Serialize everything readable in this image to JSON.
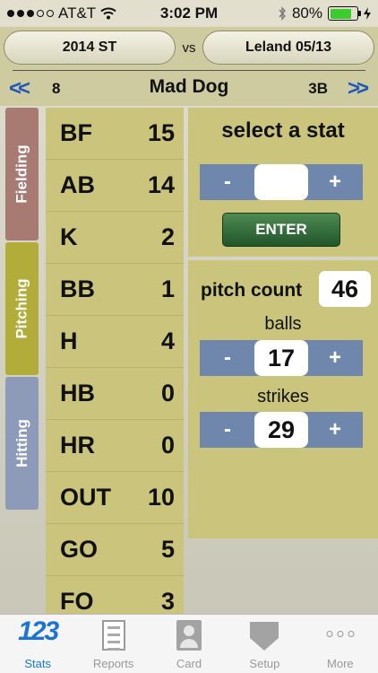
{
  "status_bar": {
    "carrier": "AT&T",
    "time": "3:02 PM",
    "battery": "80%",
    "battery_level": 0.8
  },
  "header": {
    "season_label": "2014 ST",
    "vs_label": "vs",
    "game_label": "Leland 05/13",
    "prev_arrow": "<<",
    "next_arrow": ">>",
    "player_number": "8",
    "player_name": "Mad Dog",
    "player_position": "3B"
  },
  "side_tabs": [
    {
      "label": "Fielding",
      "color": "#a87b72"
    },
    {
      "label": "Pitching",
      "color": "#b2ad3a"
    },
    {
      "label": "Hitting",
      "color": "#8d9bb8"
    }
  ],
  "stats": [
    {
      "name": "BF",
      "value": "15"
    },
    {
      "name": "AB",
      "value": "14"
    },
    {
      "name": "K",
      "value": "2"
    },
    {
      "name": "BB",
      "value": "1"
    },
    {
      "name": "H",
      "value": "4"
    },
    {
      "name": "HB",
      "value": "0"
    },
    {
      "name": "HR",
      "value": "0"
    },
    {
      "name": "OUT",
      "value": "10"
    },
    {
      "name": "GO",
      "value": "5"
    },
    {
      "name": "FO",
      "value": "3"
    }
  ],
  "select_panel": {
    "title": "select a stat",
    "minus": "-",
    "plus": "+",
    "value": "",
    "enter_label": "ENTER"
  },
  "pitch_panel": {
    "pitch_count_label": "pitch count",
    "pitch_count_value": "46",
    "balls_label": "balls",
    "balls_value": "17",
    "strikes_label": "strikes",
    "strikes_value": "29",
    "minus": "-",
    "plus": "+"
  },
  "tab_bar": {
    "stats_icon_text": "123",
    "items": [
      {
        "label": "Stats",
        "icon": "stats-icon",
        "active": true
      },
      {
        "label": "Reports",
        "icon": "reports-icon",
        "active": false
      },
      {
        "label": "Card",
        "icon": "card-icon",
        "active": false
      },
      {
        "label": "Setup",
        "icon": "setup-icon",
        "active": false
      },
      {
        "label": "More",
        "icon": "more-icon",
        "active": false
      }
    ]
  },
  "colors": {
    "accent_blue": "#1a73d8",
    "nav_arrow_blue": "#1e58b8",
    "stepper_blue": "#6f87ad",
    "enter_green": "#2f6b36",
    "panel_olive": "#cac47c"
  }
}
